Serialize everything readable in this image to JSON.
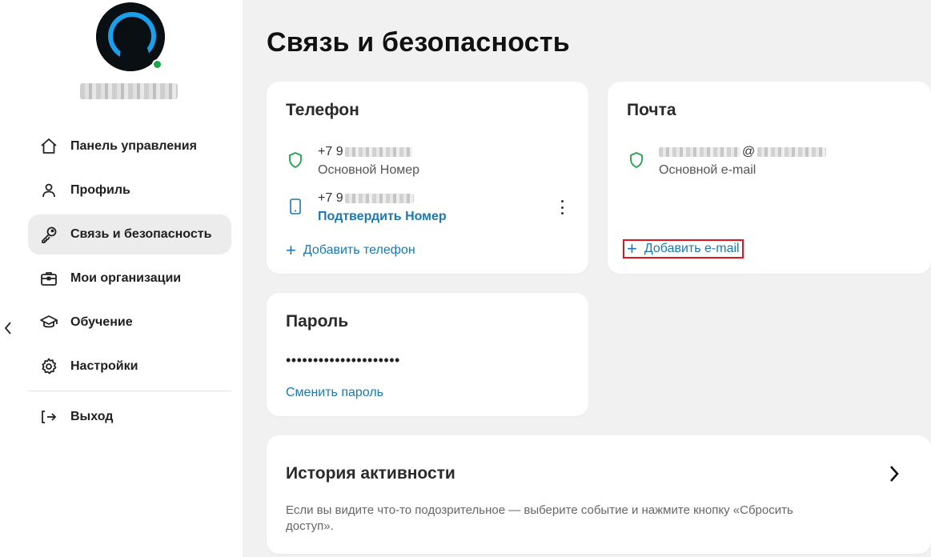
{
  "sidebar": {
    "username": "",
    "nav_items": [
      {
        "key": "dashboard",
        "label": "Панель управления",
        "icon": "home-icon"
      },
      {
        "key": "profile",
        "label": "Профиль",
        "icon": "user-icon"
      },
      {
        "key": "security",
        "label": "Связь и безопасность",
        "icon": "key-icon",
        "active": true
      },
      {
        "key": "organizations",
        "label": "Мои организации",
        "icon": "briefcase-icon"
      },
      {
        "key": "learning",
        "label": "Обучение",
        "icon": "graduation-cap-icon"
      },
      {
        "key": "settings",
        "label": "Настройки",
        "icon": "gear-icon"
      }
    ],
    "logout_label": "Выход"
  },
  "main": {
    "title": "Связь и безопасность",
    "phone_card": {
      "title": "Телефон",
      "primary": {
        "number_prefix": "+7 9",
        "subtitle": "Основной Номер"
      },
      "secondary": {
        "number_prefix": "+7 9",
        "action": "Подтвердить Номер"
      },
      "add_label": "Добавить телефон"
    },
    "email_card": {
      "title": "Почта",
      "primary": {
        "at": "@",
        "subtitle": "Основной e-mail"
      },
      "add_label": "Добавить e-mail"
    },
    "password_card": {
      "title": "Пароль",
      "masked": "•••••••••••••••••••••",
      "change_label": "Сменить пароль"
    },
    "history_card": {
      "title": "История активности",
      "description": "Если вы видите что-то подозрительное — выберите событие и нажмите кнопку «Сбросить доступ»."
    }
  },
  "colors": {
    "accent": "#1b78b3",
    "shield_green": "#21a34a",
    "highlight_red": "#e0141e",
    "active_nav_bg": "#ececec",
    "main_bg": "#f1f1f2"
  }
}
